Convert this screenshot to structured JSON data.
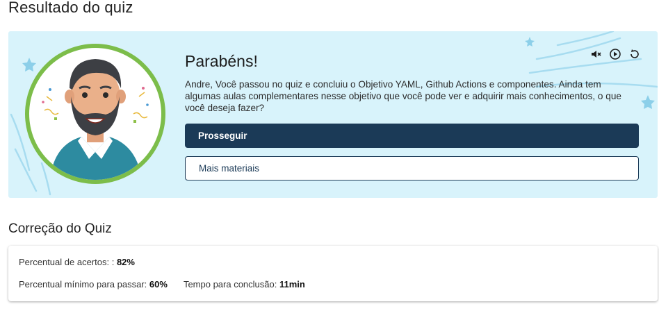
{
  "page": {
    "title": "Resultado do quiz"
  },
  "banner": {
    "heading": "Parabéns!",
    "message": "Andre, Você passou no quiz e concluiu o Objetivo YAML, Github Actions e componentes. Ainda tem algumas aulas complementares nesse objetivo que você pode ver e adquirir mais conhecimentos, o que você deseja fazer?",
    "primary_button": "Prosseguir",
    "secondary_button": "Mais materiais",
    "controls": [
      "mute-icon",
      "play-icon",
      "replay-icon"
    ],
    "colors": {
      "background": "#d8f3fb",
      "ring": "#7cbd4a",
      "primary": "#1b3a57"
    }
  },
  "correction": {
    "title": "Correção do Quiz",
    "hits_label": "Percentual de acertos: :",
    "hits_value": "82%",
    "min_label": "Percentual mínimo para passar:",
    "min_value": "60%",
    "time_label": "Tempo para conclusão:",
    "time_value": "11min"
  }
}
